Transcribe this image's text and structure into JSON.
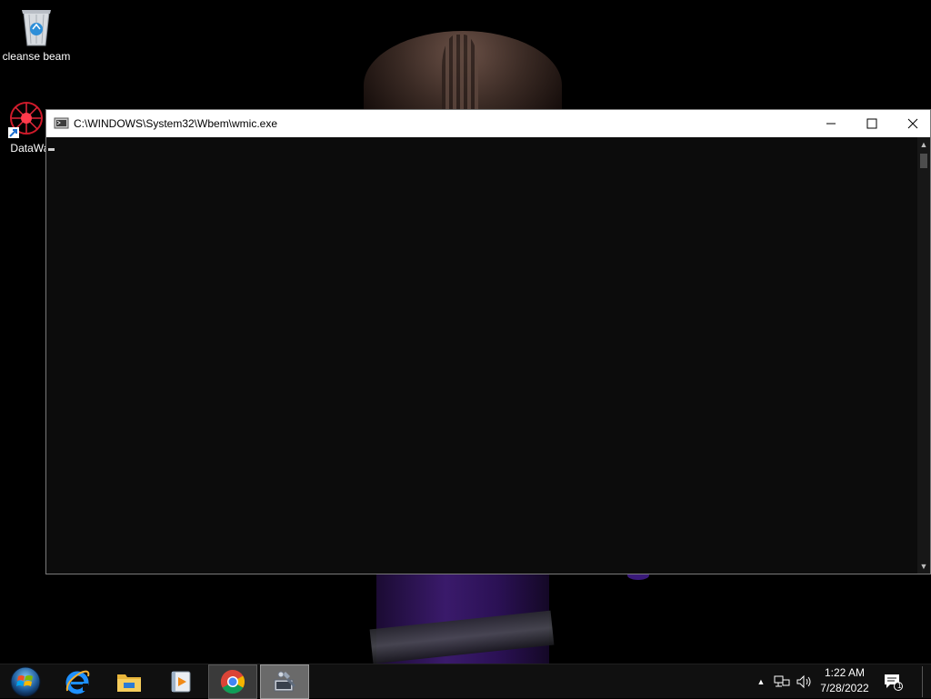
{
  "desktop": {
    "icons": [
      {
        "label": "cleanse beam",
        "icon": "recycle-bin-icon"
      },
      {
        "label": "DataWag",
        "icon": "datawag-shortcut-icon"
      }
    ]
  },
  "console_window": {
    "title": "C:\\WINDOWS\\System32\\Wbem\\wmic.exe",
    "icon": "console-icon",
    "content": "",
    "buttons": {
      "minimize": "minimize-icon",
      "maximize": "maximize-icon",
      "close": "close-icon"
    },
    "background_color": "#0c0c0c"
  },
  "taskbar": {
    "start": "windows-start-icon",
    "pinned": [
      {
        "name": "Internet Explorer",
        "icon": "internet-explorer-icon"
      },
      {
        "name": "File Explorer",
        "icon": "folder-icon"
      },
      {
        "name": "Media Player",
        "icon": "media-player-icon"
      },
      {
        "name": "Google Chrome",
        "icon": "chrome-icon"
      },
      {
        "name": "WMIC",
        "icon": "wmic-icon"
      }
    ],
    "tray": {
      "clock_time": "1:22 AM",
      "clock_date": "7/28/2022",
      "notification_count": "1"
    }
  }
}
